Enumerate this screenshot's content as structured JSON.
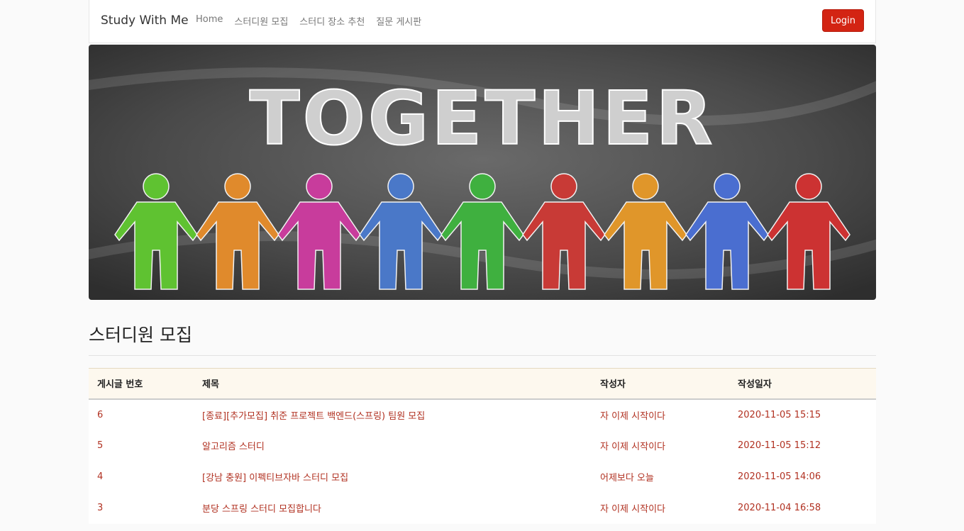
{
  "navbar": {
    "brand": "Study With Me",
    "links": [
      "Home",
      "스터디원 모집",
      "스터디 장소 추천",
      "질문 게시판"
    ],
    "login_label": "Login"
  },
  "banner": {
    "word": "TOGETHER",
    "figure_colors": [
      "#5fc231",
      "#e08a2c",
      "#c83c9c",
      "#4a78c8",
      "#3fb03f",
      "#c83a36",
      "#e0962a",
      "#4a6ed0",
      "#cc3232"
    ]
  },
  "colors": {
    "accent": "#d32413",
    "link_text": "#b13121"
  },
  "page": {
    "title": "스터디원 모집"
  },
  "table": {
    "headers": [
      "게시글 번호",
      "제목",
      "작성자",
      "작성일자"
    ],
    "rows": [
      [
        "6",
        "[종료][추가모집] 취준 프로젝트 백엔드(스프링) 팀원 모집",
        "자 이제 시작이다",
        "2020-11-05 15:15"
      ],
      [
        "5",
        "알고리즘 스터디",
        "자 이제 시작이다",
        "2020-11-05 15:12"
      ],
      [
        "4",
        "[강남 충원] 이펙티브자바 스터디 모집",
        "어제보다 오늘",
        "2020-11-05 14:06"
      ],
      [
        "3",
        "분당 스프링 스터디 모집합니다",
        "자 이제 시작이다",
        "2020-11-04 16:58"
      ]
    ]
  }
}
